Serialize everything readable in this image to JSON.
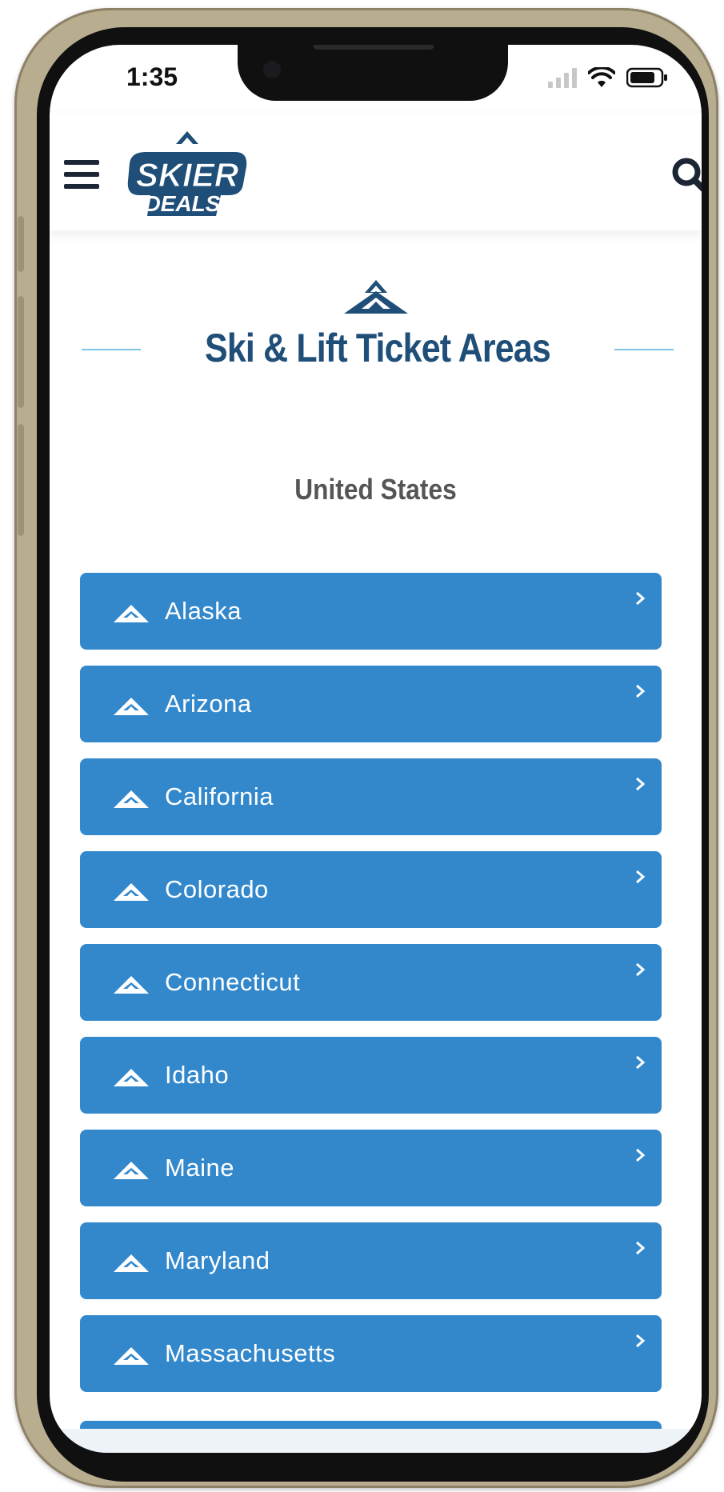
{
  "status_bar": {
    "time": "1:35"
  },
  "header": {
    "logo_text": {
      "line1": "SKIER",
      "line2": "DEALS"
    }
  },
  "page": {
    "title": "Ski & Lift Ticket Areas",
    "section_title": "United States"
  },
  "states": [
    {
      "label": "Alaska"
    },
    {
      "label": "Arizona"
    },
    {
      "label": "California"
    },
    {
      "label": "Colorado"
    },
    {
      "label": "Connecticut"
    },
    {
      "label": "Idaho"
    },
    {
      "label": "Maine"
    },
    {
      "label": "Maryland"
    },
    {
      "label": "Massachusetts"
    }
  ],
  "icons": {
    "menu": "hamburger-menu-icon",
    "search": "search-icon",
    "list_item": "mountain-icon",
    "list_item_arrow": "chevron-right-icon"
  },
  "colors": {
    "brand_dark": "#1f4e78",
    "list_item_bg": "#3388cc",
    "divider": "#7fc3e6",
    "section_text": "#555555"
  }
}
